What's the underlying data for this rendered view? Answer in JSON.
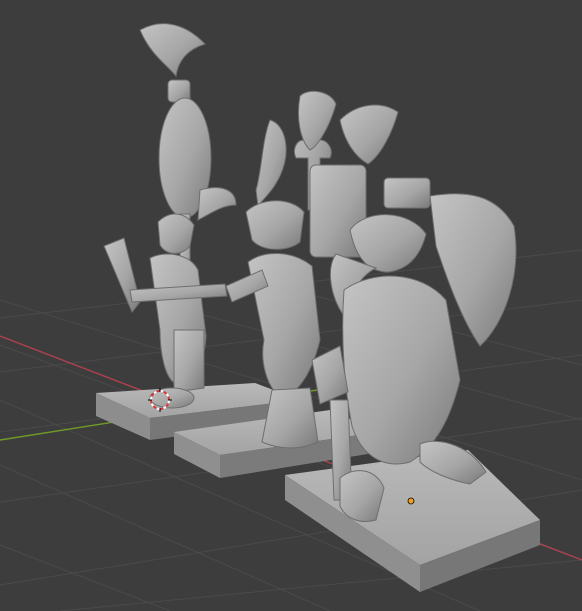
{
  "viewport": {
    "background_color": "#3d3d3d",
    "grid_color": "#4a4a4a",
    "x_axis_color": "#b0414f",
    "y_axis_color": "#6f9a2a",
    "model_color": "#a9a9a9",
    "selection_origin_color": "#f0a020"
  },
  "scene": {
    "objects": [
      {
        "icon": "rabbit-warrior-miniature"
      },
      {
        "icon": "jaguar-warrior-miniature"
      },
      {
        "icon": "eagle-warrior-miniature"
      }
    ],
    "cursor_icon": "3d-cursor-icon",
    "origin_icon": "object-origin-dot"
  }
}
